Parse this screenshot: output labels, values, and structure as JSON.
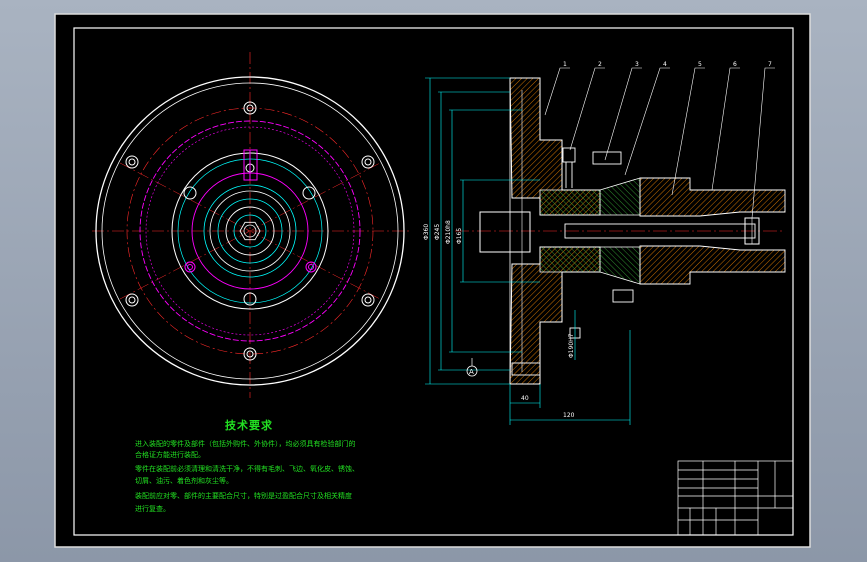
{
  "drawing": {
    "dims": {
      "d1": "Φ360",
      "d2": "Φ245",
      "d3": "Φ210h8",
      "d4": "Φ165",
      "d5": "Φ190H7",
      "width_40": "40",
      "width_120": "120"
    },
    "datum_label": "A",
    "callouts": [
      "1",
      "2",
      "3",
      "4",
      "5",
      "6",
      "7"
    ],
    "requirements": {
      "title": "技术要求",
      "lines": [
        "进入装配的零件及部件（包括外购件、外协件），均必须具有检验部门的",
        "合格证方能进行装配。",
        "零件在装配前必须清理和清洗干净，不得有毛刺、飞边、氧化皮、锈蚀、",
        "切屑、油污、着色剂和灰尘等。",
        "装配前应对零、部件的主要配合尺寸，特别是过盈配合尺寸及相关精度",
        "进行复查。"
      ]
    }
  },
  "colors": {
    "background": "#a9b3c1",
    "sheet": "#000000",
    "border": "#ffffff",
    "center": "#ff2a2a",
    "outline": "#ffffff",
    "magenta": "#ff00ff",
    "cyan": "#00ffff",
    "orange": "#ff8c00",
    "text": "#22e022"
  }
}
